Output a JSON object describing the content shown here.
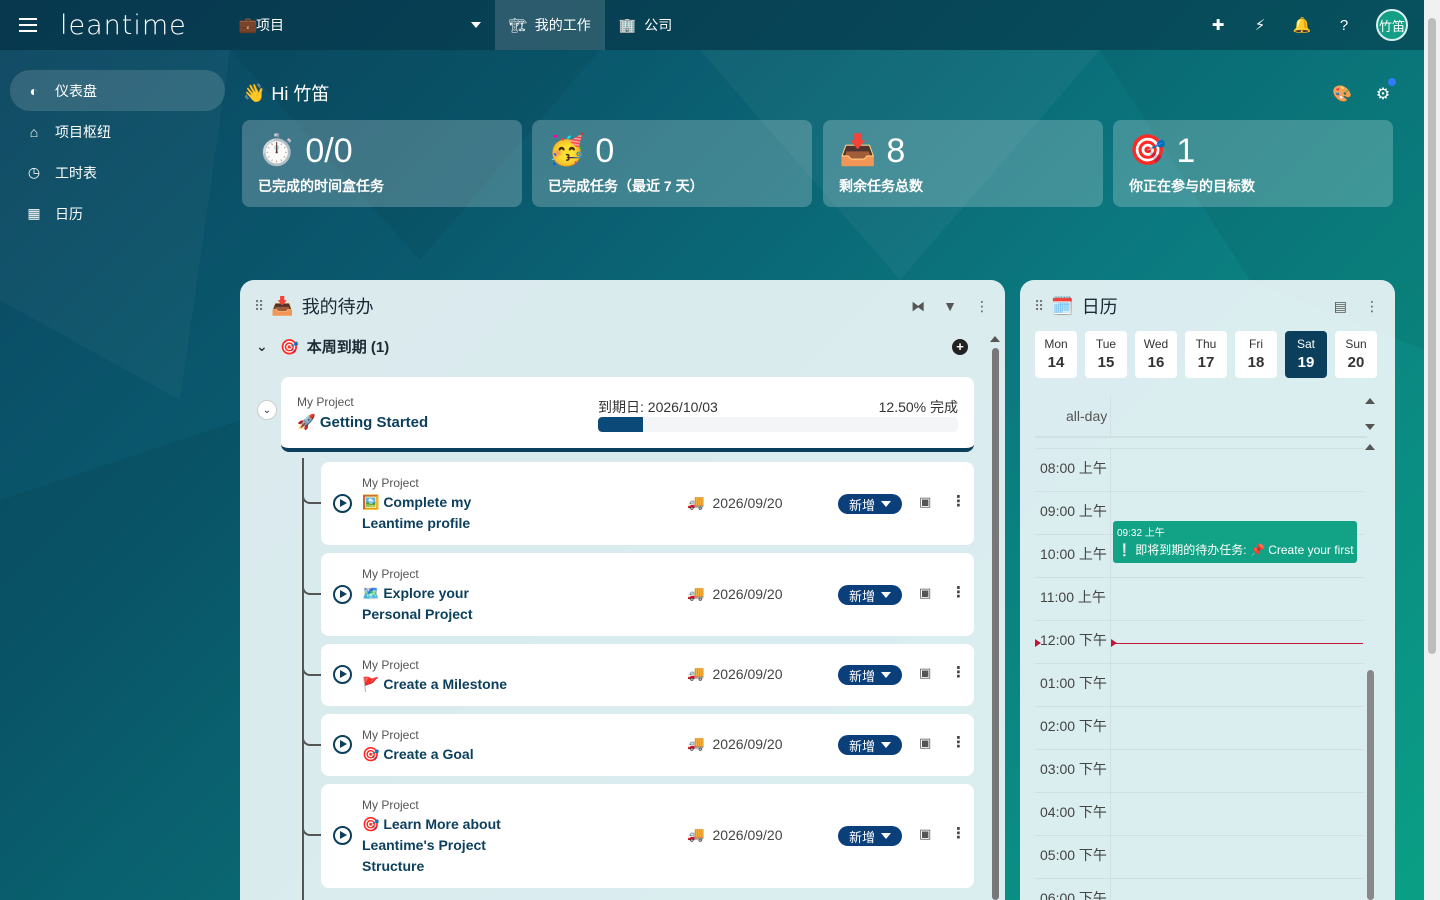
{
  "app": {
    "logo": "leantime"
  },
  "header": {
    "project_select": "项目",
    "tabs": [
      {
        "label": "我的工作"
      },
      {
        "label": "公司"
      }
    ],
    "avatar": "竹笛"
  },
  "sidebar": {
    "items": [
      {
        "label": "仪表盘",
        "icon": "dashboard-icon"
      },
      {
        "label": "项目枢纽",
        "icon": "home-icon"
      },
      {
        "label": "工时表",
        "icon": "clock-icon"
      },
      {
        "label": "日历",
        "icon": "calendar-icon"
      }
    ]
  },
  "greeting": {
    "emoji": "👋",
    "text": "Hi 竹笛"
  },
  "stats": [
    {
      "emoji": "⏱️",
      "value": "0/0",
      "label": "已完成的时间盒任务"
    },
    {
      "emoji": "🥳",
      "value": "0",
      "label": "已完成任务（最近 7 天）"
    },
    {
      "emoji": "📥",
      "value": "8",
      "label": "剩余任务总数"
    },
    {
      "emoji": "🎯",
      "value": "1",
      "label": "你正在参与的目标数"
    }
  ],
  "todo": {
    "emoji": "📥",
    "title": "我的待办",
    "group": {
      "emoji": "🎯",
      "label": "本周到期 (1)"
    },
    "milestone": {
      "project": "My Project",
      "name": "🚀 Getting Started",
      "due": "到期日: 2026/10/03",
      "percent_label": "12.50% 完成",
      "progress": 12.5
    },
    "tasks": [
      {
        "project": "My Project",
        "title_line1": "🖼️ Complete my",
        "title_line2": "Leantime profile",
        "title_line3": "",
        "date": "2026/09/20",
        "status": "新增"
      },
      {
        "project": "My Project",
        "title_line1": "🗺️ Explore your",
        "title_line2": "Personal Project",
        "title_line3": "",
        "date": "2026/09/20",
        "status": "新增"
      },
      {
        "project": "My Project",
        "title_line1": "🚩 Create a Milestone",
        "title_line2": "",
        "title_line3": "",
        "date": "2026/09/20",
        "status": "新增"
      },
      {
        "project": "My Project",
        "title_line1": "🎯 Create a Goal",
        "title_line2": "",
        "title_line3": "",
        "date": "2026/09/20",
        "status": "新增"
      },
      {
        "project": "My Project",
        "title_line1": "🎯 Learn More about",
        "title_line2": "Leantime's Project",
        "title_line3": "Structure",
        "date": "2026/09/20",
        "status": "新增"
      }
    ]
  },
  "calendar": {
    "emoji": "🗓️",
    "title": "日历",
    "days": [
      {
        "dow": "Mon",
        "num": "14"
      },
      {
        "dow": "Tue",
        "num": "15"
      },
      {
        "dow": "Wed",
        "num": "16"
      },
      {
        "dow": "Thu",
        "num": "17"
      },
      {
        "dow": "Fri",
        "num": "18"
      },
      {
        "dow": "Sat",
        "num": "19"
      },
      {
        "dow": "Sun",
        "num": "20"
      }
    ],
    "selected_day": "Sat",
    "allday_label": "all-day",
    "hours": [
      "08:00 上午",
      "09:00 上午",
      "10:00 上午",
      "11:00 上午",
      "12:00 下午",
      "01:00 下午",
      "02:00 下午",
      "03:00 下午",
      "04:00 下午",
      "05:00 下午",
      "06:00 下午"
    ],
    "event": {
      "time": "09:32 上午",
      "text": "❕ 即将到期的待办任务: 📌 Create your first task (已完成)"
    }
  },
  "colors": {
    "accent": "#0b3f5c",
    "event": "#12a386",
    "now": "#c0163a"
  }
}
